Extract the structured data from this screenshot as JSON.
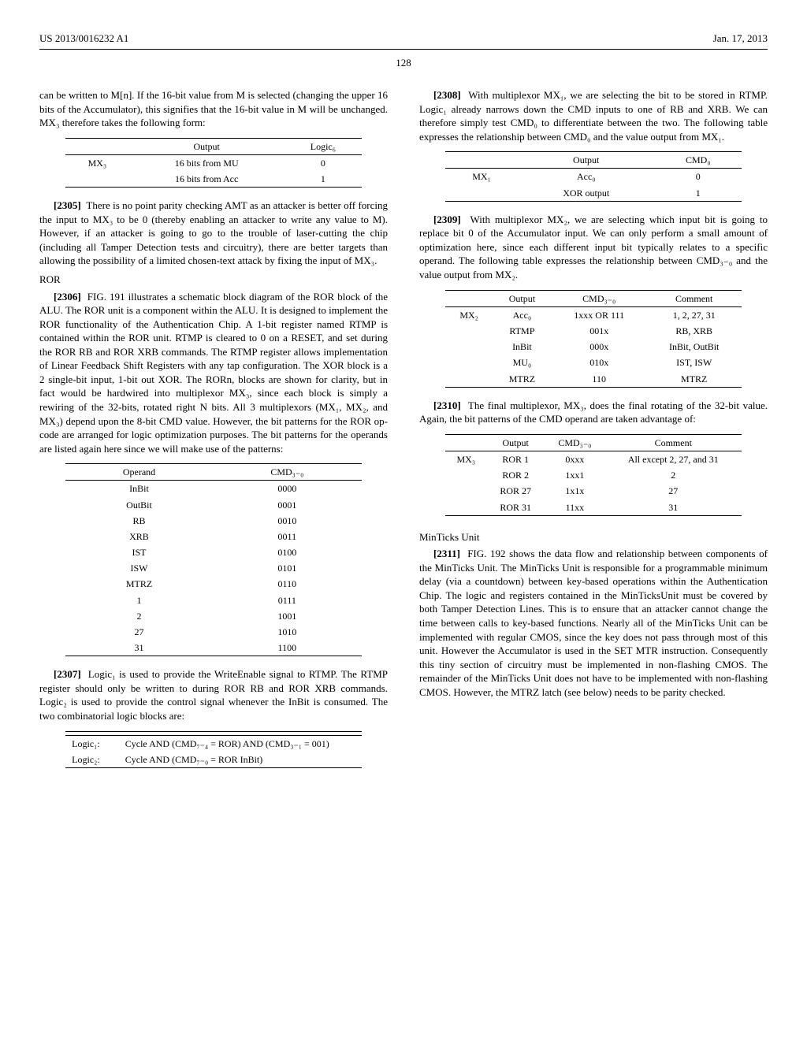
{
  "header": {
    "pub_id": "US 2013/0016232 A1",
    "date": "Jan. 17, 2013"
  },
  "page_number": "128",
  "left": {
    "intro": "can be written to M[n]. If the 16-bit value from M is selected (changing the upper 16 bits of the Accumulator), this signifies that the 16-bit value in M will be unchanged. MX₃ therefore takes the following form:",
    "table_mx3": {
      "headers": [
        "",
        "Output",
        "Logic₆"
      ],
      "rows": [
        [
          "MX₃",
          "16 bits from MU",
          "0"
        ],
        [
          "",
          "16 bits from Acc",
          "1"
        ]
      ]
    },
    "p2305": "There is no point parity checking AMT as an attacker is better off forcing the input to MX₃ to be 0 (thereby enabling an attacker to write any value to M). However, if an attacker is going to go to the trouble of laser-cutting the chip (including all Tamper Detection tests and circuitry), there are better targets than allowing the possibility of a limited chosen-text attack by fixing the input of MX₃.",
    "ror_head": "ROR",
    "p2306": "FIG. 191 illustrates a schematic block diagram of the ROR block of the ALU. The ROR unit is a component within the ALU. It is designed to implement the ROR functionality of the Authentication Chip. A 1-bit register named RTMP is contained within the ROR unit. RTMP is cleared to 0 on a RESET, and set during the ROR RB and ROR XRB commands. The RTMP register allows implementation of Linear Feedback Shift Registers with any tap configuration. The XOR block is a 2 single-bit input, 1-bit out XOR. The RORn, blocks are shown for clarity, but in fact would be hardwired into multiplexor MX₃, since each block is simply a rewiring of the 32-bits, rotated right N bits. All 3 multiplexors (MX₁, MX₂, and MX₃) depend upon the 8-bit CMD value. However, the bit patterns for the ROR op-code are arranged for logic optimization purposes. The bit patterns for the operands are listed again here since we will make use of the patterns:",
    "table_operand": {
      "headers": [
        "Operand",
        "CMD₃₋₀"
      ],
      "rows": [
        [
          "InBit",
          "0000"
        ],
        [
          "OutBit",
          "0001"
        ],
        [
          "RB",
          "0010"
        ],
        [
          "XRB",
          "0011"
        ],
        [
          "IST",
          "0100"
        ],
        [
          "ISW",
          "0101"
        ],
        [
          "MTRZ",
          "0110"
        ],
        [
          "1",
          "0111"
        ],
        [
          "2",
          "1001"
        ],
        [
          "27",
          "1010"
        ],
        [
          "31",
          "1100"
        ]
      ]
    },
    "p2307": "Logic₁ is used to provide the WriteEnable signal to RTMP. The RTMP register should only be written to during ROR RB and ROR XRB commands. Logic₂ is used to provide the control signal whenever the InBit is consumed. The two combinatorial logic blocks are:",
    "table_logic": {
      "rows": [
        [
          "Logic₁:",
          "Cycle AND (CMD₇₋₄ = ROR) AND (CMD₃₋₁ = 001)"
        ],
        [
          "Logic₂:",
          "Cycle AND (CMD₇₋₀ = ROR InBit)"
        ]
      ]
    }
  },
  "right": {
    "p2308": "With multiplexor MX₁, we are selecting the bit to be stored in RTMP. Logic₁ already narrows down the CMD inputs to one of RB and XRB. We can therefore simply test CMD₀ to differentiate between the two. The following table expresses the relationship between CMD₀ and the value output from MX₁.",
    "table_mx1": {
      "headers": [
        "",
        "Output",
        "CMD₀"
      ],
      "rows": [
        [
          "MX₁",
          "Acc₀",
          "0"
        ],
        [
          "",
          "XOR output",
          "1"
        ]
      ]
    },
    "p2309": "With multiplexor MX₂, we are selecting which input bit is going to replace bit 0 of the Accumulator input. We can only perform a small amount of optimization here, since each different input bit typically relates to a specific operand. The following table expresses the relationship between CMD₃₋₀ and the value output from MX₂.",
    "table_mx2": {
      "headers": [
        "",
        "Output",
        "CMD₃₋₀",
        "Comment"
      ],
      "rows": [
        [
          "MX₂",
          "Acc₀",
          "1xxx OR 111",
          "1, 2, 27, 31"
        ],
        [
          "",
          "RTMP",
          "001x",
          "RB, XRB"
        ],
        [
          "",
          "InBit",
          "000x",
          "InBit, OutBit"
        ],
        [
          "",
          "MU₀",
          "010x",
          "IST, ISW"
        ],
        [
          "",
          "MTRZ",
          "110",
          "MTRZ"
        ]
      ]
    },
    "p2310": "The final multiplexor, MX₃, does the final rotating of the 32-bit value. Again, the bit patterns of the CMD operand are taken advantage of:",
    "table_mx3r": {
      "headers": [
        "",
        "Output",
        "CMD₃₋₀",
        "Comment"
      ],
      "rows": [
        [
          "MX₃",
          "ROR 1",
          "0xxx",
          "All except 2, 27, and 31"
        ],
        [
          "",
          "ROR 2",
          "1xx1",
          "2"
        ],
        [
          "",
          "ROR 27",
          "1x1x",
          "27"
        ],
        [
          "",
          "ROR 31",
          "11xx",
          "31"
        ]
      ]
    },
    "minticks_head": "MinTicks Unit",
    "p2311": "FIG. 192 shows the data flow and relationship between components of the MinTicks Unit. The MinTicks Unit is responsible for a programmable minimum delay (via a countdown) between key-based operations within the Authentication Chip. The logic and registers contained in the MinTicksUnit must be covered by both Tamper Detection Lines. This is to ensure that an attacker cannot change the time between calls to key-based functions. Nearly all of the MinTicks Unit can be implemented with regular CMOS, since the key does not pass through most of this unit. However the Accumulator is used in the SET MTR instruction. Consequently this tiny section of circuitry must be implemented in non-flashing CMOS. The remainder of the MinTicks Unit does not have to be implemented with non-flashing CMOS. However, the MTRZ latch (see below) needs to be parity checked."
  }
}
